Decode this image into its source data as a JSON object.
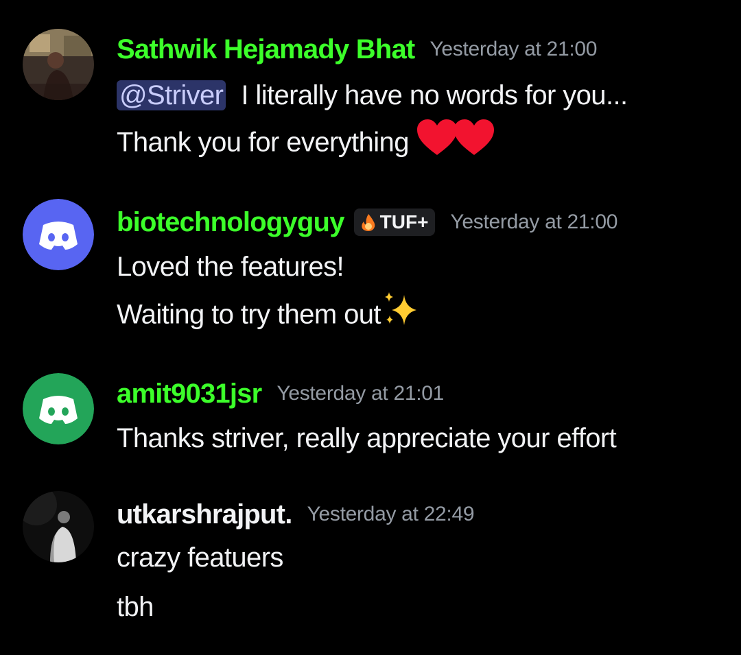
{
  "messages": [
    {
      "username": "Sathwik Hejamady Bhat",
      "timestamp": "Yesterday at 21:00",
      "mention": "@Striver",
      "lines": [
        "I literally have no words for you...",
        "Thank you for everything"
      ],
      "emojis": [
        "red-heart",
        "red-heart"
      ]
    },
    {
      "username": "biotechnologyguy",
      "badge": "TUF+",
      "timestamp": "Yesterday at 21:00",
      "lines": [
        "Loved the features!",
        "Waiting to try them out"
      ],
      "emojis": [
        "sparkles"
      ],
      "avatar_color": "#5865f2"
    },
    {
      "username": "amit9031jsr",
      "timestamp": "Yesterday at 21:01",
      "lines": [
        "Thanks striver, really appreciate your effort"
      ],
      "avatar_color": "#23a559"
    },
    {
      "username": "utkarshrajput.",
      "timestamp": "Yesterday at 22:49",
      "lines": [
        "crazy featuers",
        "tbh"
      ]
    }
  ],
  "colors": {
    "background": "#000000",
    "username_green": "#3cff2a",
    "timestamp": "#949ba4",
    "mention_bg": "#2c3468"
  }
}
